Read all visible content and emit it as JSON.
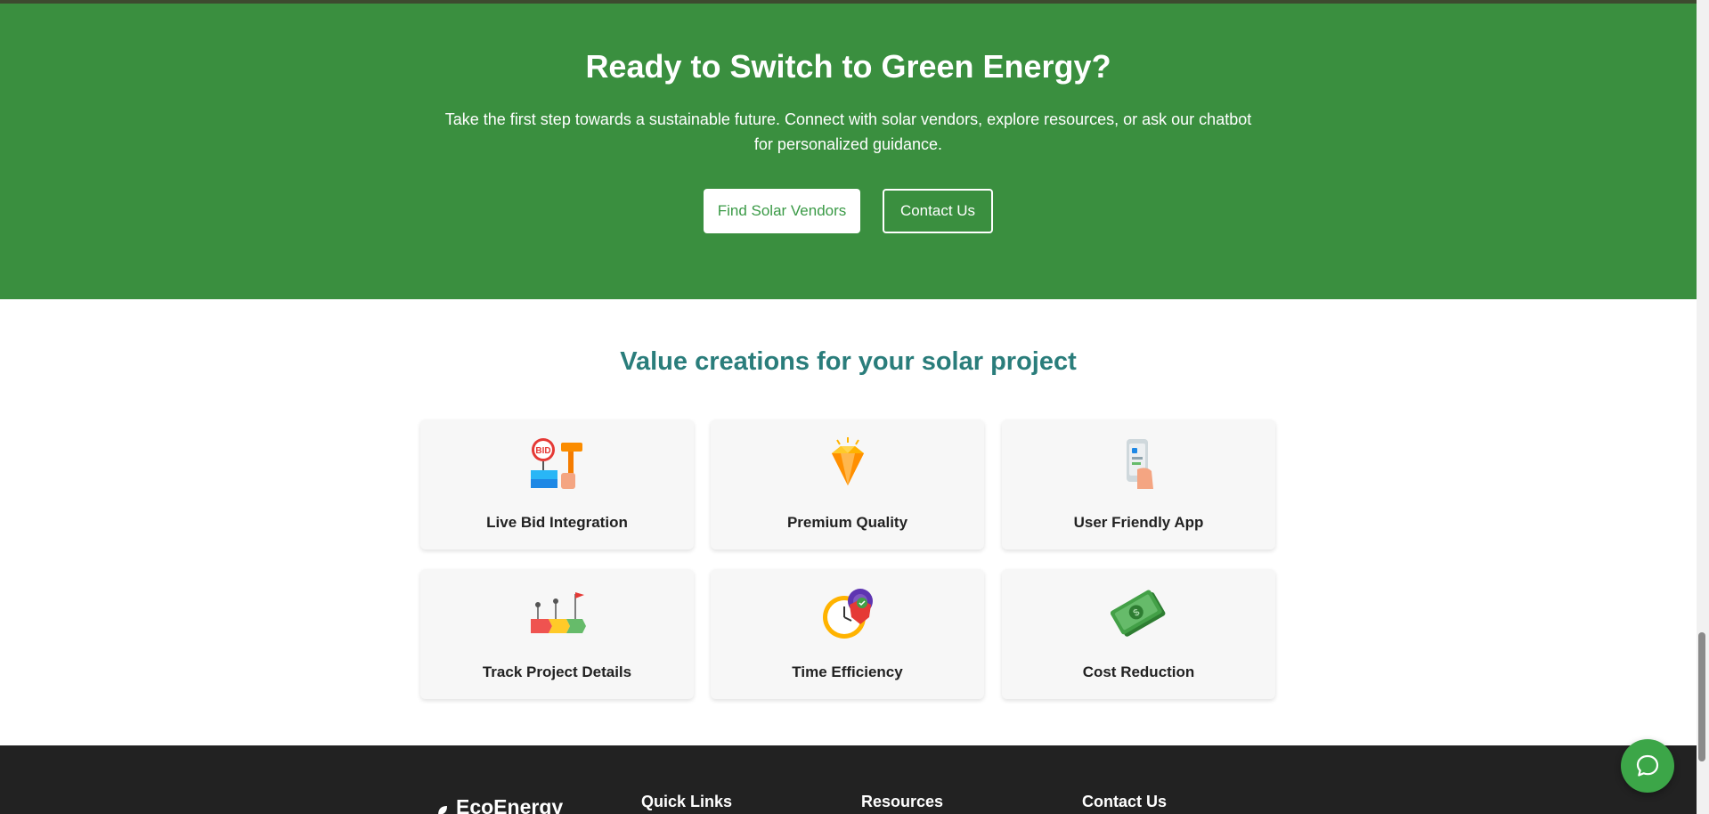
{
  "cta": {
    "title": "Ready to Switch to Green Energy?",
    "text": "Take the first step towards a sustainable future. Connect with solar vendors, explore resources, or ask our chatbot for personalized guidance.",
    "primary_button": "Find Solar Vendors",
    "secondary_button": "Contact Us"
  },
  "values": {
    "title": "Value creations for your solar project",
    "cards": [
      {
        "label": "Live Bid Integration",
        "icon": "bid-auction-icon"
      },
      {
        "label": "Premium Quality",
        "icon": "diamond-icon"
      },
      {
        "label": "User Friendly App",
        "icon": "phone-hand-icon"
      },
      {
        "label": "Track Project Details",
        "icon": "progress-milestone-icon"
      },
      {
        "label": "Time Efficiency",
        "icon": "clock-gear-icon"
      },
      {
        "label": "Cost Reduction",
        "icon": "money-bills-icon"
      }
    ]
  },
  "footer": {
    "brand": "EcoEnergy",
    "headings": [
      "Quick Links",
      "Resources",
      "Contact Us"
    ]
  },
  "colors": {
    "cta_green": "#3a8f3f",
    "heading_teal": "#2a7d7b",
    "footer_dark": "#222222",
    "chat_green": "#3ca648"
  }
}
